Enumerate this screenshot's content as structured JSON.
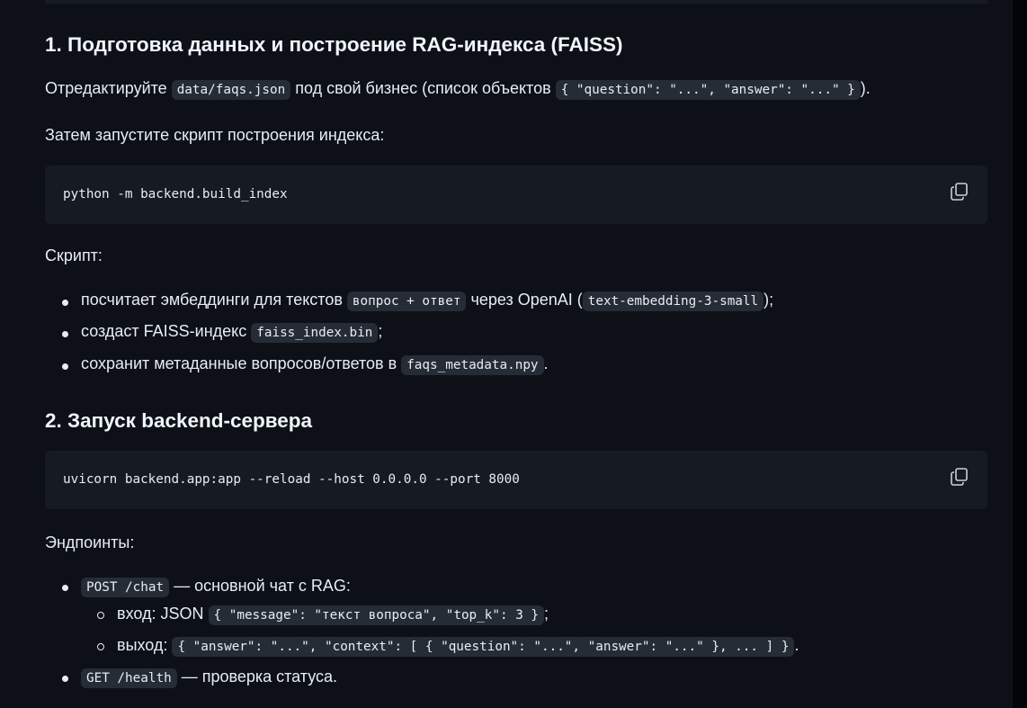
{
  "section1": {
    "heading": "1. Подготовка данных и построение RAG-индекса (FAISS)",
    "p1_pre": "Отредактируйте",
    "p1_code1": "data/faqs.json",
    "p1_mid": "под свой бизнес (список объектов",
    "p1_code2": "{ \"question\": \"...\", \"answer\": \"...\" }",
    "p1_post": ").",
    "p2": "Затем запустите скрипт построения индекса:",
    "code": "python -m backend.build_index",
    "script_label": "Скрипт:",
    "bullets": [
      {
        "pre": "посчитает эмбеддинги для текстов",
        "code": "вопрос + ответ",
        "mid": "через OpenAI (",
        "code2": "text-embedding-3-small",
        "post": ");"
      },
      {
        "pre": "создаст FAISS-индекс",
        "code": "faiss_index.bin",
        "post": ";"
      },
      {
        "pre": "сохранит метаданные вопросов/ответов в",
        "code": "faqs_metadata.npy",
        "post": "."
      }
    ]
  },
  "section2": {
    "heading": "2. Запуск backend-сервера",
    "code": "uvicorn backend.app:app --reload --host 0.0.0.0 --port 8000",
    "endpoints_label": "Эндпоинты:",
    "chat": {
      "code": "POST /chat",
      "text": "— основной чат с RAG:"
    },
    "chat_in": {
      "label": "вход: JSON",
      "code": "{ \"message\": \"текст вопроса\", \"top_k\": 3 }",
      "post": ";"
    },
    "chat_out": {
      "label": "выход:",
      "code": "{ \"answer\": \"...\", \"context\": [ { \"question\": \"...\", \"answer\": \"...\" }, ... ] }",
      "post": "."
    },
    "health": {
      "code": "GET /health",
      "text": "— проверка статуса."
    }
  },
  "icons": {
    "copy": "copy-icon"
  }
}
